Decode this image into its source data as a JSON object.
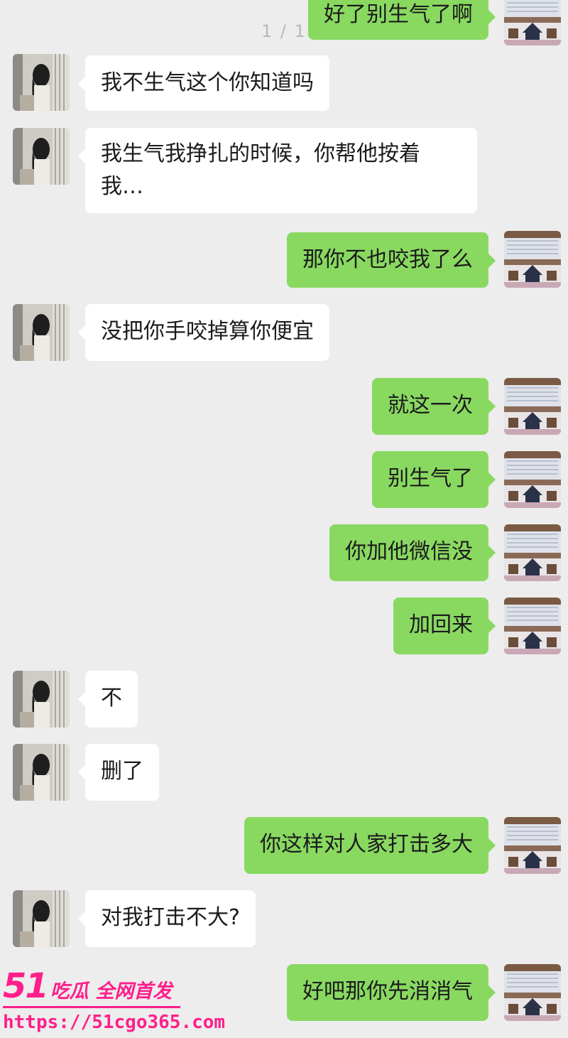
{
  "page_indicator": "1 / 1",
  "messages": [
    {
      "sender": "me",
      "text": "好了别生气了啊"
    },
    {
      "sender": "them",
      "text": "我不生气这个你知道吗"
    },
    {
      "sender": "them",
      "text": "我生气我挣扎的时候，你帮他按着\n我…"
    },
    {
      "sender": "me",
      "text": "那你不也咬我了么"
    },
    {
      "sender": "them",
      "text": "没把你手咬掉算你便宜"
    },
    {
      "sender": "me",
      "text": "就这一次"
    },
    {
      "sender": "me",
      "text": "别生气了"
    },
    {
      "sender": "me",
      "text": "你加他微信没"
    },
    {
      "sender": "me",
      "text": "加回来"
    },
    {
      "sender": "them",
      "text": "不"
    },
    {
      "sender": "them",
      "text": "删了"
    },
    {
      "sender": "me",
      "text": "你这样对人家打击多大"
    },
    {
      "sender": "them",
      "text": "对我打击不大?"
    },
    {
      "sender": "me",
      "text": "好吧那你先消消气"
    }
  ],
  "watermark": {
    "brand_number": "51",
    "brand_name": "吃瓜 全网首发",
    "url": "https://51cgo365.com"
  },
  "colors": {
    "chat_background": "#ededed",
    "bubble_me": "#89d961",
    "bubble_them": "#ffffff",
    "watermark": "#ff1f8a"
  }
}
